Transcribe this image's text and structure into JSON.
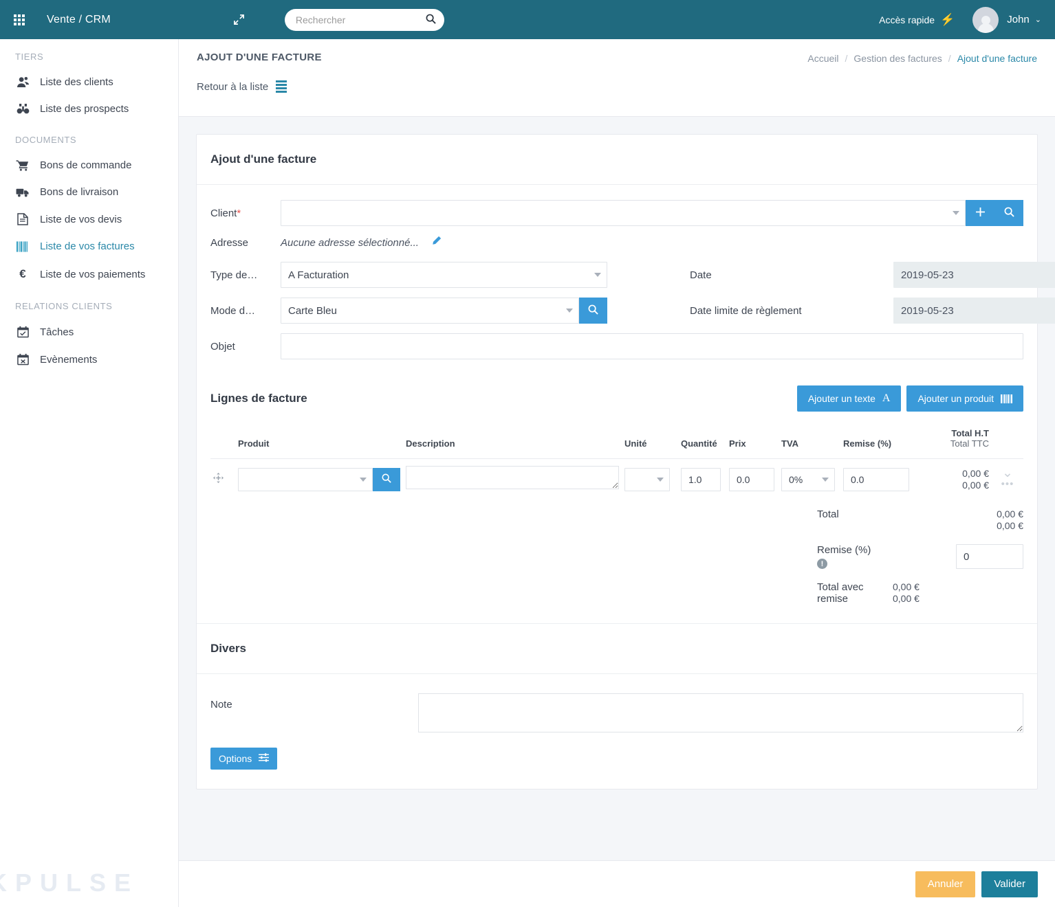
{
  "topbar": {
    "brand": "Vente / CRM",
    "search_placeholder": "Rechercher",
    "search_value": "",
    "quick_access": "Accès rapide",
    "user_name": "John"
  },
  "sidebar": {
    "groups": [
      {
        "title": "TIERS",
        "items": [
          {
            "label": "Liste des clients",
            "icon": "user-icon",
            "active": false
          },
          {
            "label": "Liste des prospects",
            "icon": "binoculars-icon",
            "active": false
          }
        ]
      },
      {
        "title": "DOCUMENTS",
        "items": [
          {
            "label": "Bons de commande",
            "icon": "cart-icon",
            "active": false
          },
          {
            "label": "Bons de livraison",
            "icon": "truck-icon",
            "active": false
          },
          {
            "label": "Liste de vos devis",
            "icon": "document-icon",
            "active": false
          },
          {
            "label": "Liste de vos factures",
            "icon": "barcode-icon",
            "active": true
          },
          {
            "label": "Liste de vos paiements",
            "icon": "euro-icon",
            "active": false
          }
        ]
      },
      {
        "title": "RELATIONS CLIENTS",
        "items": [
          {
            "label": "Tâches",
            "icon": "calendar-check-icon",
            "active": false
          },
          {
            "label": "Evènements",
            "icon": "calendar-x-icon",
            "active": false
          }
        ]
      }
    ]
  },
  "page": {
    "title": "AJOUT D'UNE FACTURE",
    "back_link": "Retour à la liste",
    "breadcrumb": {
      "home": "Accueil",
      "section": "Gestion des factures",
      "current": "Ajout d'une facture",
      "separator": "/"
    }
  },
  "form": {
    "card_title": "Ajout d'une facture",
    "client": {
      "label": "Client",
      "required_mark": "*",
      "value": ""
    },
    "adresse": {
      "label": "Adresse",
      "value": "Aucune adresse sélectionné..."
    },
    "type": {
      "label": "Type de…",
      "value": "A Facturation"
    },
    "date": {
      "label": "Date",
      "value": "2019-05-23"
    },
    "mode": {
      "label": "Mode d…",
      "value": "Carte Bleu"
    },
    "date_limite": {
      "label": "Date limite de règlement",
      "value": "2019-05-23"
    },
    "objet": {
      "label": "Objet",
      "value": ""
    }
  },
  "lines": {
    "title": "Lignes de facture",
    "add_text_button": "Ajouter un texte",
    "add_product_button": "Ajouter un produit",
    "columns": {
      "produit": "Produit",
      "description": "Description",
      "unite": "Unité",
      "quantite": "Quantité",
      "prix": "Prix",
      "tva": "TVA",
      "remise": "Remise (%)",
      "total_ht": "Total H.T",
      "total_ttc": "Total TTC"
    },
    "rows": [
      {
        "produit": "",
        "description": "",
        "unite": "",
        "quantite": "1.0",
        "prix": "0.0",
        "tva": "0%",
        "remise": "0.0",
        "total_ht": "0,00 €",
        "total_ttc": "0,00 €"
      }
    ],
    "totals": {
      "total_label": "Total",
      "total_ht": "0,00 €",
      "total_ttc": "0,00 €",
      "remise_label": "Remise (%)",
      "remise_value": "0",
      "total_remise_label": "Total avec remise",
      "total_remise_ht": "0,00 €",
      "total_remise_ttc": "0,00 €"
    }
  },
  "divers": {
    "title": "Divers",
    "note_label": "Note",
    "note_value": "",
    "options_button": "Options"
  },
  "footer": {
    "cancel": "Annuler",
    "validate": "Valider",
    "watermark": "KPULSE"
  },
  "colors": {
    "topbar": "#206a7f",
    "accent_blue": "#3a9ad9",
    "link_teal": "#2a88a8",
    "cancel_orange": "#f7bc5d",
    "validate_teal": "#1d7f9b",
    "required_red": "#e8534f",
    "bolt_yellow": "#f7b733"
  }
}
